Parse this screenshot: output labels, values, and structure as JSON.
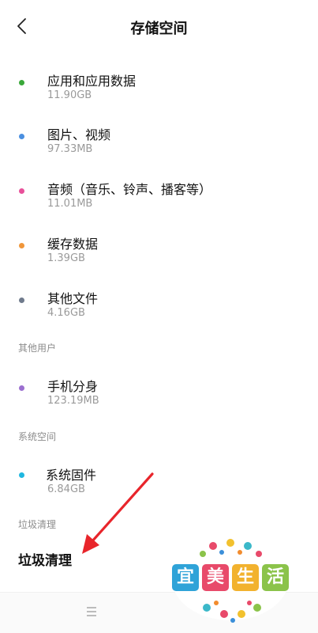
{
  "header": {
    "title": "存储空间"
  },
  "storage_items": [
    {
      "label": "应用和应用数据",
      "size": "11.90GB",
      "color": "#3aa83a"
    },
    {
      "label": "图片、视频",
      "size": "97.33MB",
      "color": "#4a8fe0"
    },
    {
      "label": "音频（音乐、铃声、播客等）",
      "size": "11.01MB",
      "color": "#e8509a"
    },
    {
      "label": "缓存数据",
      "size": "1.39GB",
      "color": "#f0963a"
    },
    {
      "label": "其他文件",
      "size": "4.16GB",
      "color": "#6f7a8c"
    }
  ],
  "sections": {
    "other_users": "其他用户",
    "system_space": "系统空间",
    "junk_clean": "垃圾清理"
  },
  "other_users_items": [
    {
      "label": "手机分身",
      "size": "123.19MB",
      "color": "#9b6fd0"
    }
  ],
  "system_items": [
    {
      "label": "系统固件",
      "size": "6.84GB",
      "color": "#1fb7e0"
    }
  ],
  "junk_action": {
    "label": "垃圾清理"
  },
  "watermark": {
    "chars": [
      "宜",
      "美",
      "生",
      "活"
    ]
  },
  "icons": {
    "back": "chevron-left-icon",
    "menu": "menu-icon"
  }
}
